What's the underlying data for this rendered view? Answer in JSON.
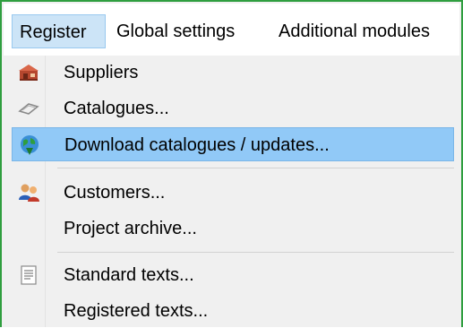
{
  "menubar": {
    "items": [
      "Register",
      "Global settings",
      "Additional modules"
    ]
  },
  "menu": {
    "items": [
      {
        "label": "Suppliers",
        "icon": "suppliers-icon"
      },
      {
        "label": "Catalogues...",
        "icon": "catalogue-icon"
      },
      {
        "label": "Download catalogues / updates...",
        "icon": "globe-download-icon",
        "highlighted": true
      },
      {
        "label": "Customers...",
        "icon": "customers-icon"
      },
      {
        "label": "Project archive..."
      },
      {
        "label": "Standard texts...",
        "icon": "document-text-icon"
      },
      {
        "label": "Registered texts..."
      }
    ]
  },
  "colors": {
    "frame": "#2f9e3f",
    "active_menu": "#cce4f7",
    "highlight": "#91c9f7"
  }
}
